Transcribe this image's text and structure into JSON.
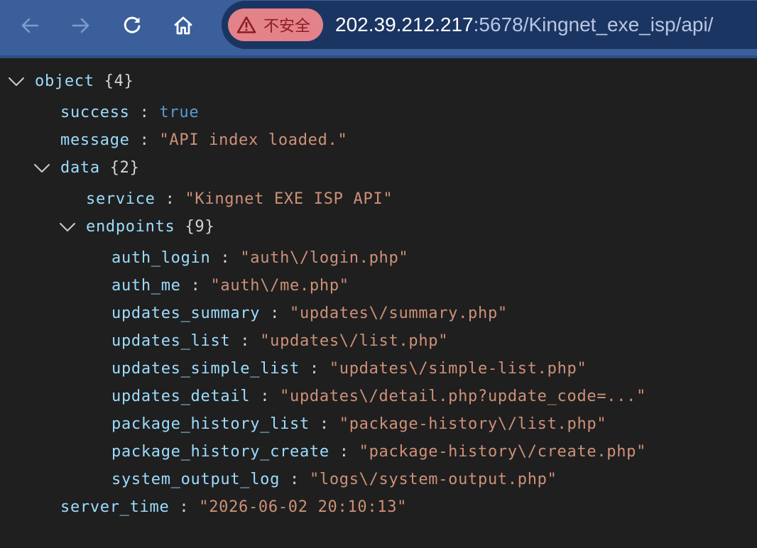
{
  "browser": {
    "security_label": "不安全",
    "url_host": "202.39.212.217",
    "url_rest": ":5678/Kingnet_exe_isp/api/",
    "icons": {
      "back": "arrow-left-icon",
      "forward": "arrow-right-icon",
      "reload": "reload-icon",
      "home": "home-icon",
      "warning": "warning-triangle-icon"
    }
  },
  "json_view": {
    "root": {
      "label": "object",
      "count": "{4}"
    },
    "success": {
      "key": "success",
      "value": "true"
    },
    "message": {
      "key": "message",
      "value": "\"API index loaded.\""
    },
    "data": {
      "key": "data",
      "count": "{2}",
      "service": {
        "key": "service",
        "value": "\"Kingnet EXE ISP API\""
      },
      "endpoints": {
        "key": "endpoints",
        "count": "{9}",
        "items": [
          {
            "key": "auth_login",
            "value": "\"auth\\/login.php\""
          },
          {
            "key": "auth_me",
            "value": "\"auth\\/me.php\""
          },
          {
            "key": "updates_summary",
            "value": "\"updates\\/summary.php\""
          },
          {
            "key": "updates_list",
            "value": "\"updates\\/list.php\""
          },
          {
            "key": "updates_simple_list",
            "value": "\"updates\\/simple-list.php\""
          },
          {
            "key": "updates_detail",
            "value": "\"updates\\/detail.php?update_code=...\""
          },
          {
            "key": "package_history_list",
            "value": "\"package-history\\/list.php\""
          },
          {
            "key": "package_history_create",
            "value": "\"package-history\\/create.php\""
          },
          {
            "key": "system_output_log",
            "value": "\"logs\\/system-output.php\""
          }
        ]
      }
    },
    "server_time": {
      "key": "server_time",
      "value": "\"2026-06-02 20:10:13\""
    },
    "separator": ":",
    "colors": {
      "key": "#9cdcfe",
      "string": "#ce9178",
      "boolean": "#569cd6",
      "background": "#1f1f1f",
      "toolbar": "#3a5f9b"
    }
  }
}
